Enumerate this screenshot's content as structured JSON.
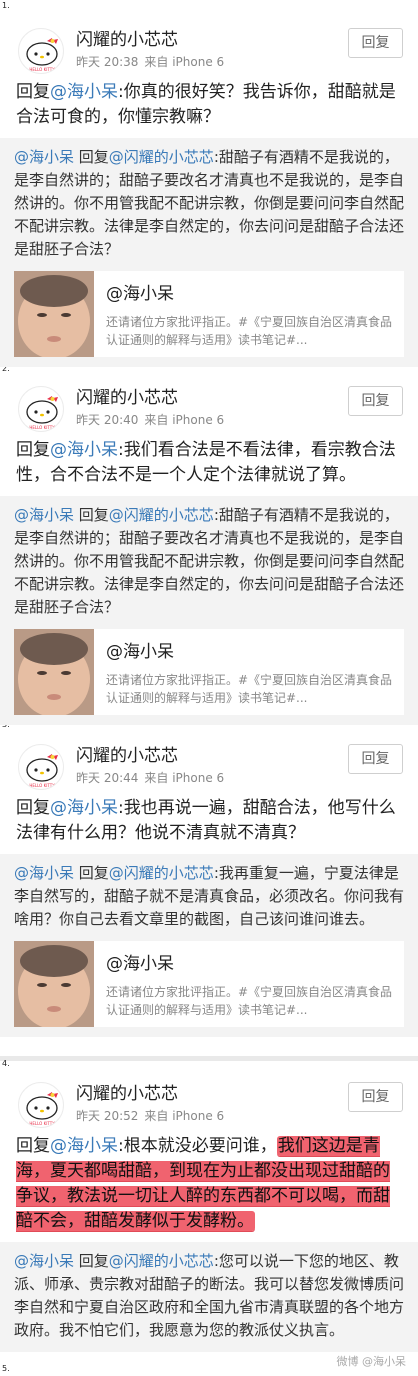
{
  "posts": [
    {
      "index": "1.",
      "user": "闪耀的小芯芯",
      "time": "昨天 20:38",
      "source": "来自 iPhone 6",
      "reply_button": "回复",
      "reply_prefix": "回复",
      "reply_at": "@海小呆",
      "reply_text": ":你真的很好笑？我告诉你，甜醅就是合法可食的，你懂宗教嘛？",
      "quote_author": "@海小呆",
      "quote_mid": " 回复",
      "quote_at": "@闪耀的小芯芯",
      "quote_text": ":甜醅子有酒精不是我说的，是李自然讲的；甜醅子要改名才清真也不是我说的，是李自然讲的。你不用管我配不配讲宗教，你倒是要问问李自然配不配讲宗教。法律是李自然定的，你去问问是甜醅子合法还是甜胚子合法？",
      "ref_title": "@海小呆",
      "ref_desc": "还请诸位方家批评指正。#《宁夏回族自治区清真食品认证通则的解释与适用》读书笔记#..."
    },
    {
      "index": "2.",
      "user": "闪耀的小芯芯",
      "time": "昨天 20:40",
      "source": "来自 iPhone 6",
      "reply_button": "回复",
      "reply_prefix": "回复",
      "reply_at": "@海小呆",
      "reply_text": ":我们看合法是不看法律，看宗教合法性，合不合法不是一个人定个法律就说了算。",
      "quote_author": "@海小呆",
      "quote_mid": " 回复",
      "quote_at": "@闪耀的小芯芯",
      "quote_text": ":甜醅子有酒精不是我说的，是李自然讲的；甜醅子要改名才清真也不是我说的，是李自然讲的。你不用管我配不配讲宗教，你倒是要问问李自然配不配讲宗教。法律是李自然定的，你去问问是甜醅子合法还是甜胚子合法？",
      "ref_title": "@海小呆",
      "ref_desc": "还请诸位方家批评指正。#《宁夏回族自治区清真食品认证通则的解释与适用》读书笔记#..."
    },
    {
      "index": "3.",
      "user": "闪耀的小芯芯",
      "time": "昨天 20:44",
      "source": "来自 iPhone 6",
      "reply_button": "回复",
      "reply_prefix": "回复",
      "reply_at": "@海小呆",
      "reply_text": ":我也再说一遍，甜醅合法，他写什么法律有什么用？他说不清真就不清真？",
      "quote_author": "@海小呆",
      "quote_mid": " 回复",
      "quote_at": "@闪耀的小芯芯",
      "quote_text": ":我再重复一遍，宁夏法律是李自然写的，甜醅子就不是清真食品，必须改名。你问我有啥用？你自己去看文章里的截图，自己该问谁问谁去。",
      "ref_title": "@海小呆",
      "ref_desc": "还请诸位方家批评指正。#《宁夏回族自治区清真食品认证通则的解释与适用》读书笔记#..."
    },
    {
      "index": "4.",
      "user": "闪耀的小芯芯",
      "time": "昨天 20:52",
      "source": "来自 iPhone 6",
      "reply_button": "回复",
      "reply_prefix": "回复",
      "reply_at": "@海小呆",
      "reply_text": ":根本就没必要问谁，",
      "reply_highlight": "我们这边是青海，夏天都喝甜醅，到现在为止都没出现过甜醅的争议，教法说一切让人醉的东西都不可以喝，而甜醅不会，甜醅发酵似于发酵粉。",
      "quote_author": "@海小呆",
      "quote_mid": " 回复",
      "quote_at": "@闪耀的小芯芯",
      "quote_text": ":您可以说一下您的地区、教派、师承、贵宗教对甜醅子的断法。我可以替您发微博质问李自然和宁夏自治区政府和全国九省市清真联盟的各个地方政府。我不怕它们，我愿意为您的教派仗义执言。"
    }
  ],
  "end_index": "5.",
  "watermark": "微博 @海小呆",
  "colors": {
    "link": "#3a7ab8",
    "highlight": "#f0636f",
    "quote_bg": "#f3f3f3",
    "separator": "#e9e9e9"
  }
}
